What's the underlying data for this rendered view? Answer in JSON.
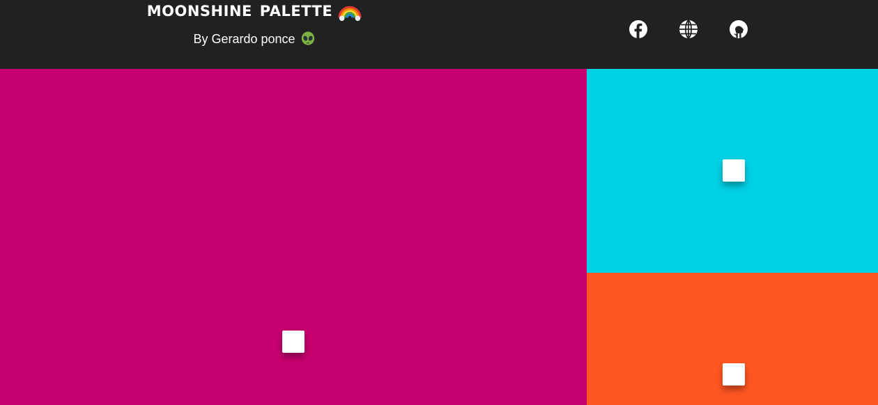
{
  "header": {
    "title": "Moonshine Palette",
    "byline": "By Gerardo ponce",
    "title_emoji_icon": "rainbow-icon",
    "byline_emoji_icon": "alien-icon",
    "background": "#212121"
  },
  "social": [
    {
      "name": "facebook",
      "icon": "facebook-icon"
    },
    {
      "name": "website",
      "icon": "globe-icon"
    },
    {
      "name": "github",
      "icon": "github-icon"
    }
  ],
  "palette": {
    "primary": {
      "color": "#c8006f"
    },
    "top_right": {
      "color": "#00d2e6"
    },
    "bottom_right": {
      "color": "#ff5722"
    }
  }
}
